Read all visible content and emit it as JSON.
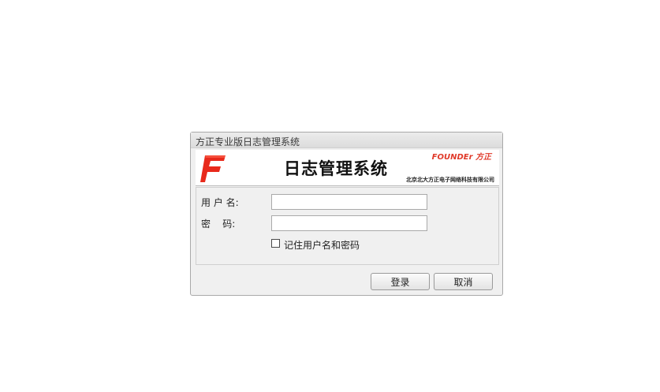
{
  "window": {
    "title": "方正专业版日志管理系统"
  },
  "banner": {
    "title": "日志管理系统",
    "brand": "FOUNDEr 方正",
    "company": "北京北大方正电子网络科技有限公司",
    "logo_color": "#e8291b"
  },
  "form": {
    "username_label": "用 户 名:",
    "username_value": "",
    "password_label": "密    码:",
    "password_value": "",
    "remember_label": "记住用户名和密码",
    "remember_checked": false
  },
  "buttons": {
    "login": "登录",
    "cancel": "取消"
  }
}
